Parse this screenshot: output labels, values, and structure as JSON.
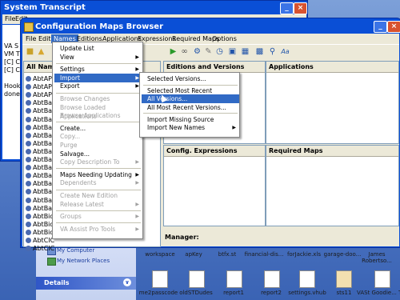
{
  "desktop": {
    "left_panel": {
      "links": [
        "My Computer",
        "My Network Places"
      ],
      "details_label": "Details"
    },
    "icons_row1": [
      "workspace",
      "apKey",
      "btfx.st",
      "financial-dis...",
      "forJackie.xls",
      "garage-doo...",
      "James Robertso..."
    ],
    "icons_row2": [
      "me2passcode",
      "oldSTDudes",
      "report1",
      "report2",
      "settings.vhub",
      "sts11",
      "VASt Goodie... Tools Arg..."
    ]
  },
  "system_transcript": {
    "title": "System Transcript",
    "menu": [
      "File",
      "Edit"
    ],
    "lines": [
      "VA S",
      "VM T",
      "[C] C",
      "[C] C",
      "",
      "Hook",
      "done"
    ]
  },
  "browser": {
    "title": "Configuration Maps Browser",
    "menu": [
      "File",
      "Edit",
      "Names",
      "Editions",
      "Applications",
      "Expressions",
      "Required Maps",
      "Options"
    ],
    "active_menu": "Names",
    "list_header": "All Nam",
    "list_rows": [
      "AbtAPP",
      "AbtAPP",
      "AbtAPP",
      "AbtBas",
      "AbtBas",
      "AbtBas",
      "AbtBas",
      "AbtBas",
      "AbtBas",
      "AbtBas",
      "AbtBas",
      "AbtBas",
      "AbtBas",
      "AbtBas",
      "AbtBas",
      "AbtBas",
      "AbtBas",
      "AbtBid",
      "AbtBid",
      "AbtBid",
      "AbtCIC",
      "AbtCIC"
    ],
    "pane_editions": "Editions and Versions",
    "pane_applications": "Applications",
    "pane_expressions": "Config. Expressions",
    "pane_required": "Required Maps",
    "manager_label": "Manager:"
  },
  "names_menu": [
    {
      "label": "Update List",
      "disabled": false,
      "sub": false
    },
    {
      "label": "View",
      "disabled": false,
      "sub": true
    },
    {
      "sep": true
    },
    {
      "label": "Settings",
      "disabled": false,
      "sub": true
    },
    {
      "label": "Import",
      "disabled": false,
      "sub": true,
      "selected": true
    },
    {
      "label": "Export",
      "disabled": false,
      "sub": true
    },
    {
      "sep": true
    },
    {
      "label": "Browse Changes",
      "disabled": true,
      "sub": false
    },
    {
      "label": "Browse Loaded Applications",
      "disabled": true,
      "sub": false
    },
    {
      "label": "Browse Applications",
      "disabled": true,
      "sub": false
    },
    {
      "sep": true
    },
    {
      "label": "Create...",
      "disabled": false,
      "sub": false
    },
    {
      "label": "Copy...",
      "disabled": true,
      "sub": false
    },
    {
      "label": "Purge",
      "disabled": true,
      "sub": false
    },
    {
      "label": "Salvage...",
      "disabled": false,
      "sub": false
    },
    {
      "label": "Copy Description To",
      "disabled": true,
      "sub": true
    },
    {
      "sep": true
    },
    {
      "label": "Maps Needing Updating",
      "disabled": false,
      "sub": true
    },
    {
      "label": "Dependents",
      "disabled": true,
      "sub": true
    },
    {
      "sep": true
    },
    {
      "label": "Create New Edition",
      "disabled": true,
      "sub": false
    },
    {
      "label": "Release Latest",
      "disabled": true,
      "sub": true
    },
    {
      "sep": true
    },
    {
      "label": "Groups",
      "disabled": true,
      "sub": true
    },
    {
      "sep": true
    },
    {
      "label": "VA Assist Pro Tools",
      "disabled": true,
      "sub": true
    }
  ],
  "import_menu": [
    {
      "label": "Selected Versions...",
      "sub": false
    },
    {
      "sep": true
    },
    {
      "label": "Selected Most Recent Versions...",
      "sub": false
    },
    {
      "label": "All Versions...",
      "sub": false,
      "selected": true
    },
    {
      "label": "All Most Recent Versions...",
      "sub": false
    },
    {
      "sep": true
    },
    {
      "label": "Import Missing Source",
      "sub": false
    },
    {
      "label": "Import New Names",
      "sub": true
    }
  ],
  "colors": {
    "titlebar": "#0a4fd6",
    "selection": "#316ac5",
    "menu_bg": "#ece9d8"
  }
}
